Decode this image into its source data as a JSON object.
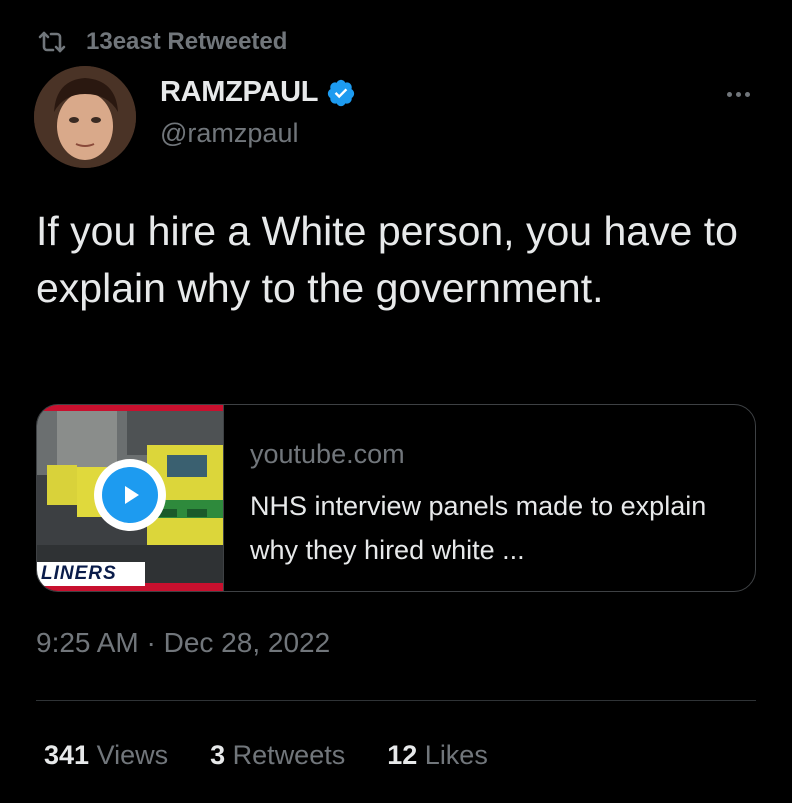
{
  "retweet": {
    "label": "13east Retweeted",
    "icon": "retweet-icon"
  },
  "author": {
    "name": "RAMZPAUL",
    "handle": "@ramzpaul",
    "verified": true,
    "verified_color": "#1d9bf0"
  },
  "tweet": {
    "text": "If you hire a White person, you have to explain why to the government.",
    "timestamp": "9:25 AM · Dec 28, 2022"
  },
  "card": {
    "domain": "youtube.com",
    "title": "NHS interview panels made to explain why they hired white ...",
    "thumbnail_banner": "LINERS"
  },
  "stats": {
    "views_count": "341",
    "views_label": "Views",
    "retweets_count": "3",
    "retweets_label": "Retweets",
    "likes_count": "12",
    "likes_label": "Likes"
  },
  "colors": {
    "background": "#000000",
    "text": "#e7e9ea",
    "muted": "#71767b",
    "accent": "#1d9bf0"
  }
}
